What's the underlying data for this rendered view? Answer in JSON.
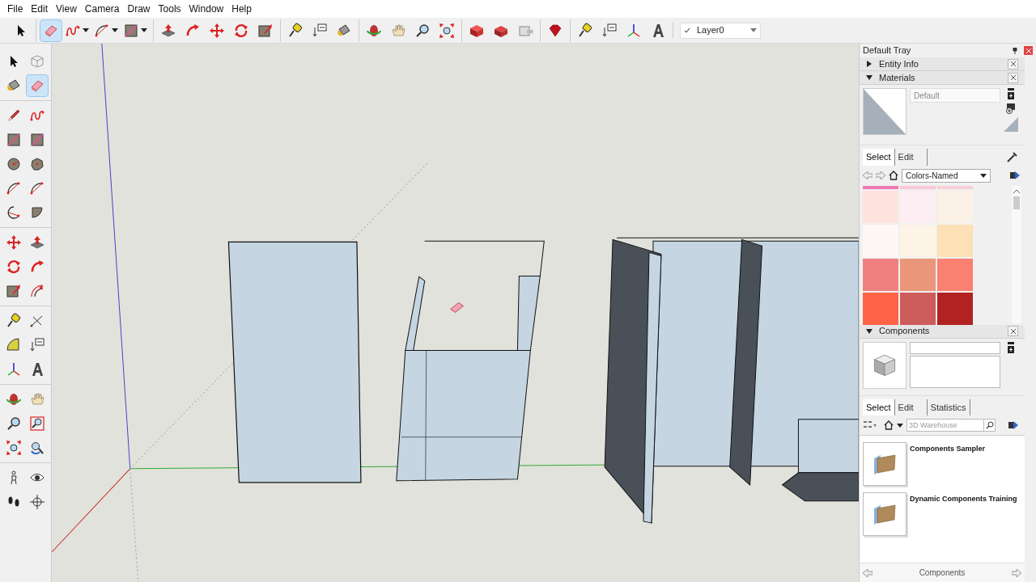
{
  "menu": [
    "File",
    "Edit",
    "View",
    "Camera",
    "Draw",
    "Tools",
    "Window",
    "Help"
  ],
  "toolbar": {
    "groups": [
      [
        {
          "kind": "select",
          "selected": false,
          "has_menu": false
        }
      ],
      [
        {
          "kind": "eraser",
          "selected": true,
          "has_menu": false
        },
        {
          "kind": "freehand",
          "selected": false,
          "has_menu": true
        },
        {
          "kind": "arc",
          "selected": false,
          "has_menu": true
        },
        {
          "kind": "rectangle",
          "selected": false,
          "has_menu": true
        }
      ],
      [
        {
          "kind": "pushpull",
          "selected": false,
          "has_menu": false
        },
        {
          "kind": "followme",
          "selected": false,
          "has_menu": false
        },
        {
          "kind": "move",
          "selected": false,
          "has_menu": false
        },
        {
          "kind": "rotate",
          "selected": false,
          "has_menu": false
        },
        {
          "kind": "scale",
          "selected": false,
          "has_menu": false
        }
      ],
      [
        {
          "kind": "tape",
          "selected": false,
          "has_menu": false
        },
        {
          "kind": "text",
          "selected": false,
          "has_menu": false
        },
        {
          "kind": "paint",
          "selected": false,
          "has_menu": false
        }
      ],
      [
        {
          "kind": "orbit",
          "selected": false,
          "has_menu": false
        },
        {
          "kind": "pan",
          "selected": false,
          "has_menu": false
        },
        {
          "kind": "zoom",
          "selected": false,
          "has_menu": false
        },
        {
          "kind": "zoomext",
          "selected": false,
          "has_menu": false
        }
      ],
      [
        {
          "kind": "warehouse",
          "selected": false,
          "has_menu": false
        },
        {
          "kind": "sharecomp",
          "selected": false,
          "has_menu": false
        },
        {
          "kind": "extension",
          "selected": false,
          "has_menu": false
        }
      ],
      [
        {
          "kind": "ruby",
          "selected": false,
          "has_menu": false
        }
      ],
      [
        {
          "kind": "tape",
          "selected": false,
          "has_menu": false
        },
        {
          "kind": "text",
          "selected": false,
          "has_menu": false
        },
        {
          "kind": "axes",
          "selected": false,
          "has_menu": false
        },
        {
          "kind": "text3d",
          "selected": false,
          "has_menu": false
        }
      ]
    ],
    "layer": {
      "name": "Layer0"
    }
  },
  "left_toolbar": {
    "groups": [
      [
        {
          "kind": "select",
          "selected": false
        },
        {
          "kind": "component",
          "selected": false
        },
        {
          "kind": "paint",
          "selected": false
        },
        {
          "kind": "eraser",
          "selected": true
        }
      ],
      [
        {
          "kind": "pencil",
          "selected": false
        },
        {
          "kind": "freehand",
          "selected": false
        },
        {
          "kind": "rectangle",
          "selected": false
        },
        {
          "kind": "rotrect",
          "selected": false
        },
        {
          "kind": "circle",
          "selected": false
        },
        {
          "kind": "polygon",
          "selected": false
        },
        {
          "kind": "arc",
          "selected": false
        },
        {
          "kind": "arc2",
          "selected": false
        },
        {
          "kind": "arc3",
          "selected": false
        },
        {
          "kind": "pie",
          "selected": false
        }
      ],
      [
        {
          "kind": "move",
          "selected": false
        },
        {
          "kind": "pushpull",
          "selected": false
        },
        {
          "kind": "rotate",
          "selected": false
        },
        {
          "kind": "followme",
          "selected": false
        },
        {
          "kind": "scale",
          "selected": false
        },
        {
          "kind": "offset",
          "selected": false
        }
      ],
      [
        {
          "kind": "tape",
          "selected": false
        },
        {
          "kind": "dimension",
          "selected": false
        },
        {
          "kind": "protractor",
          "selected": false
        },
        {
          "kind": "text",
          "selected": false
        },
        {
          "kind": "axes",
          "selected": false
        },
        {
          "kind": "text3d",
          "selected": false
        }
      ],
      [
        {
          "kind": "orbit",
          "selected": false
        },
        {
          "kind": "pan",
          "selected": false
        },
        {
          "kind": "zoom",
          "selected": false
        },
        {
          "kind": "zoomwindow",
          "selected": false
        },
        {
          "kind": "zoomext",
          "selected": false
        },
        {
          "kind": "previous",
          "selected": false
        }
      ],
      [
        {
          "kind": "position",
          "selected": false
        },
        {
          "kind": "lookaround",
          "selected": false
        },
        {
          "kind": "walk",
          "selected": false
        },
        {
          "kind": "section",
          "selected": false
        }
      ]
    ]
  },
  "tray": {
    "title": "Default Tray",
    "panels": [
      {
        "kind": "entity_info",
        "title": "Entity Info",
        "expanded": false
      },
      {
        "kind": "materials",
        "title": "Materials",
        "expanded": true,
        "name_value": "Default",
        "tabs": [
          {
            "label": "Select",
            "selected": true
          },
          {
            "label": "Edit",
            "selected": false
          }
        ],
        "library": "Colors-Named",
        "swatches": [
          {
            "color": "#f078b4"
          },
          {
            "color": "#f8c8d8"
          },
          {
            "color": "#f8d0d8"
          },
          {
            "color": "#fde2de"
          },
          {
            "color": "#fdeef3"
          },
          {
            "color": "#fcf1e6"
          },
          {
            "color": "#fdf8f5"
          },
          {
            "color": "#fdf3e6"
          },
          {
            "color": "#fde0b6"
          },
          {
            "color": "#f08080"
          },
          {
            "color": "#e9967a"
          },
          {
            "color": "#fa8072"
          },
          {
            "color": "#ff6347"
          },
          {
            "color": "#cd5c5c"
          },
          {
            "color": "#b22222"
          }
        ]
      },
      {
        "kind": "components",
        "title": "Components",
        "expanded": true,
        "tabs": [
          {
            "label": "Select",
            "selected": true
          },
          {
            "label": "Edit",
            "selected": false
          },
          {
            "label": "Statistics",
            "selected": false
          }
        ],
        "search_placeholder": "3D Warehouse",
        "items": [
          "Components Sampler",
          "Dynamic Components Training"
        ],
        "footer": "Components"
      }
    ]
  }
}
